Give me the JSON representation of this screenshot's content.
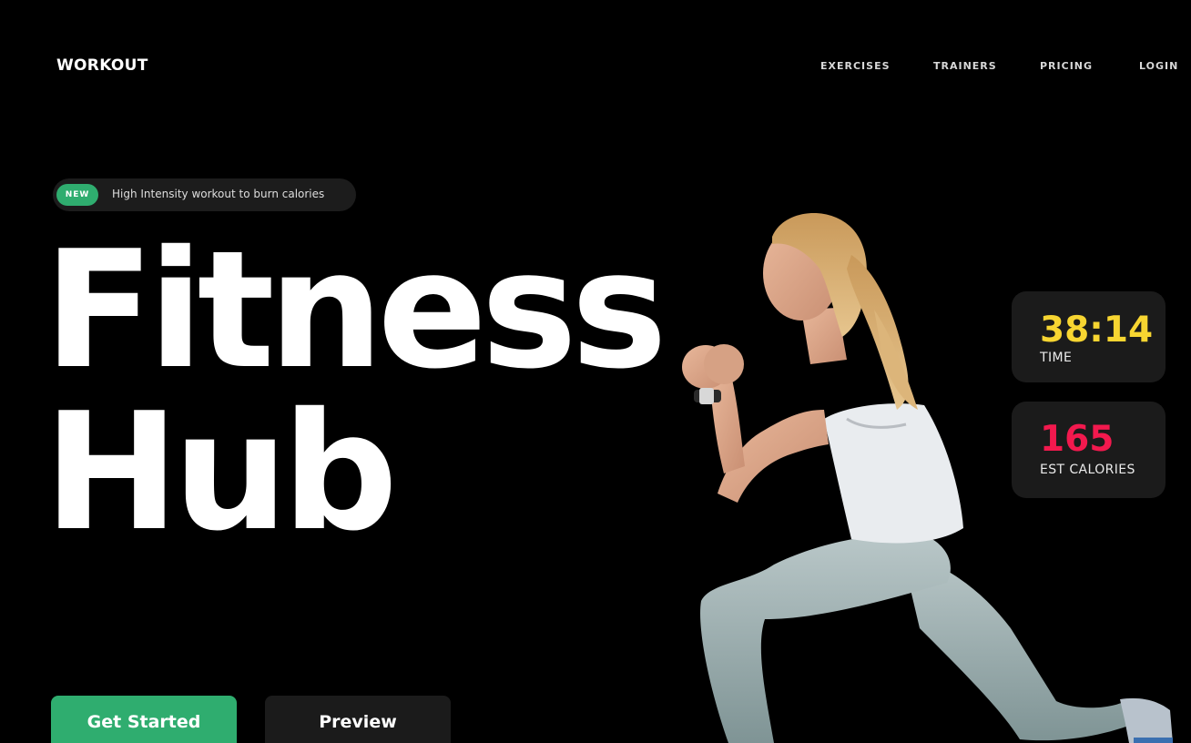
{
  "brand": {
    "logo": "WORKOUT"
  },
  "nav": {
    "items": [
      "EXERCISES",
      "TRAINERS",
      "PRICING",
      "LOGIN"
    ]
  },
  "badge": {
    "tag": "NEW",
    "text": "High Intensity workout to burn calories",
    "tag_color": "#2fad6f"
  },
  "hero": {
    "line1": "Fitness",
    "line2": "Hub"
  },
  "stats": {
    "time": {
      "value": "38:14",
      "label": "TIME",
      "color": "#f7d531"
    },
    "calories": {
      "value": "165",
      "label": "EST CALORIES",
      "color": "#f2194e"
    }
  },
  "cta": {
    "primary": "Get Started",
    "secondary": "Preview",
    "primary_color": "#2fad6f"
  },
  "hero_image": {
    "icon": "athlete-lunge-illustration"
  }
}
